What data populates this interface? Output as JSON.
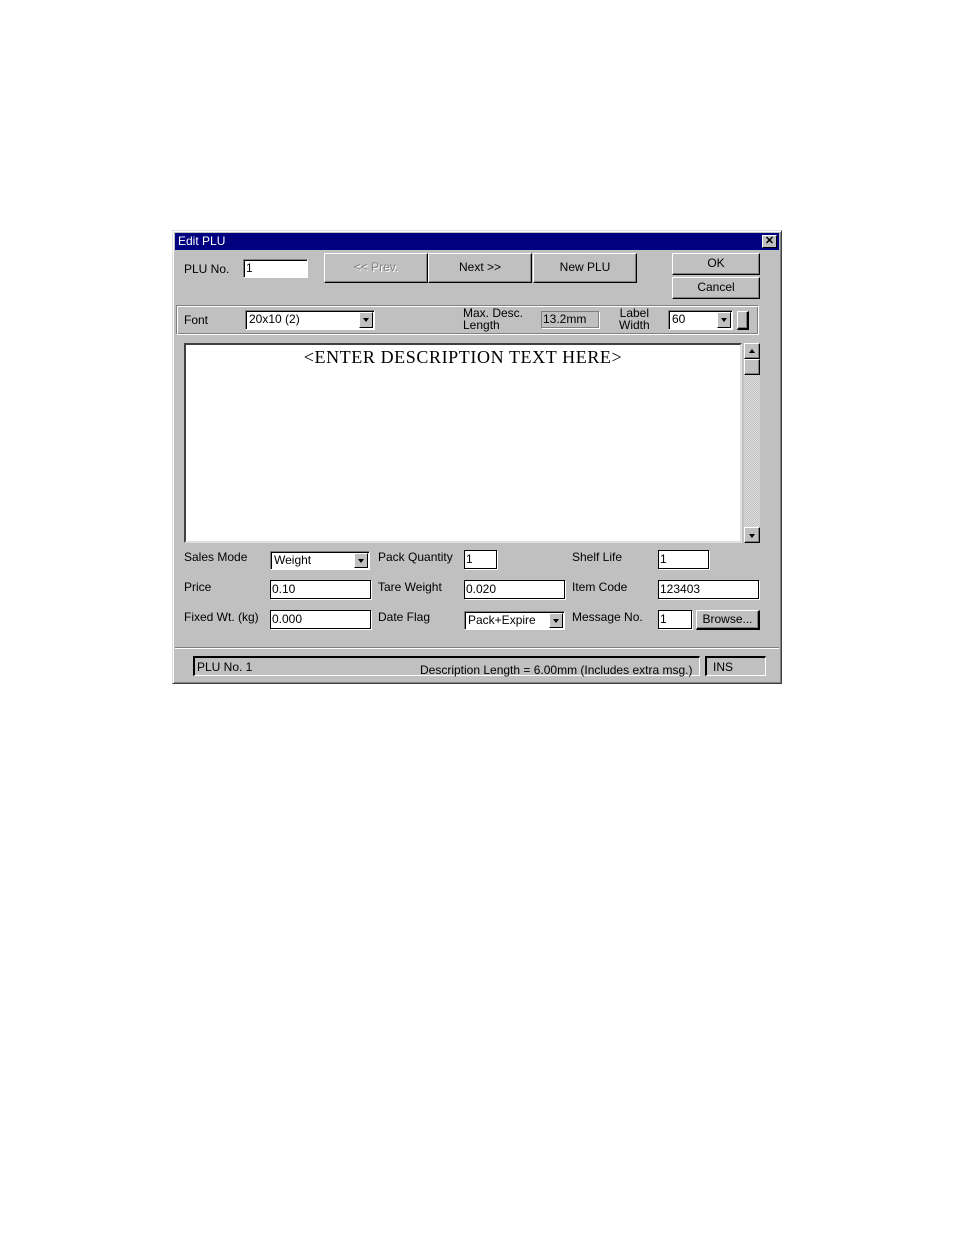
{
  "window": {
    "title": "Edit PLU",
    "close_icon": "close-x-icon"
  },
  "top_row": {
    "plu_no_label": "PLU No.",
    "plu_no_value": "1",
    "prev_label": "<< Prev.",
    "next_label": "Next >>",
    "new_plu_label": "New PLU",
    "ok_label": "OK",
    "cancel_label": "Cancel"
  },
  "font_row": {
    "font_label": "Font",
    "font_value": "20x10 (2)",
    "max_desc_label_line1": "Max. Desc.",
    "max_desc_label_line2": "Length",
    "max_desc_value": "13.2mm",
    "label_width_label_line1": "Label",
    "label_width_label_line2": "Width",
    "label_width_value": "60"
  },
  "description": {
    "text": "<ENTER DESCRIPTION TEXT HERE>"
  },
  "fields": {
    "sales_mode_label": "Sales Mode",
    "sales_mode_value": "Weight",
    "price_label": "Price",
    "price_value": "0.10",
    "fixed_wt_label": "Fixed Wt. (kg)",
    "fixed_wt_value": "0.000",
    "pack_quantity_label": "Pack Quantity",
    "pack_quantity_value": "1",
    "tare_weight_label": "Tare Weight",
    "tare_weight_value": "0.020",
    "date_flag_label": "Date Flag",
    "date_flag_value": "Pack+Expire",
    "shelf_life_label": "Shelf Life",
    "shelf_life_value": "1",
    "item_code_label": "Item Code",
    "item_code_value": "123403",
    "message_no_label": "Message No.",
    "message_no_value": "1",
    "browse_label": "Browse..."
  },
  "status_bar": {
    "plu_text": "PLU No. 1",
    "description_length_text": "Description Length = 6.00mm (Includes extra msg.)",
    "mode_text": "INS"
  },
  "colors": {
    "title_bar": "#000080",
    "face": "#c0c0c0"
  }
}
